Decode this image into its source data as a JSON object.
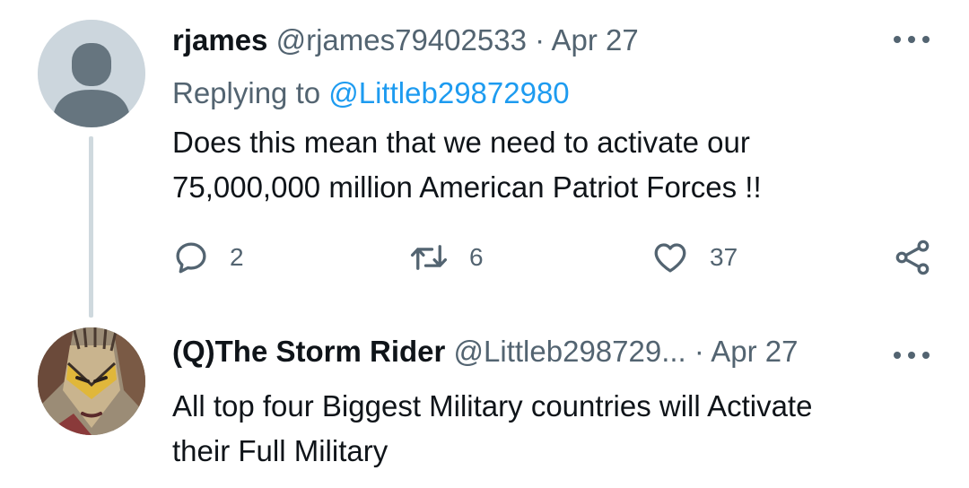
{
  "tweets": [
    {
      "display_name": "rjames",
      "handle": "@rjames79402533",
      "separator": "·",
      "date": "Apr 27",
      "replying_prefix": "Replying to",
      "replying_to": "@Littleb29872980",
      "text_lines": [
        "Does this mean that we need to activate our",
        "75,000,000 million American Patriot Forces !!"
      ],
      "stats": {
        "replies": "2",
        "retweets": "6",
        "likes": "37"
      },
      "avatar_icon": "default-profile-icon"
    },
    {
      "display_name": "(Q)The Storm Rider",
      "handle": "@Littleb298729...",
      "separator": "·",
      "date": "Apr 27",
      "text_lines": [
        "All top four Biggest Military countries will Activate",
        "their Full Military"
      ],
      "avatar_icon": "painted-face-avatar"
    }
  ],
  "colors": {
    "text": "#0f1419",
    "secondary": "#536471",
    "link": "#1d9bf0",
    "thread_line": "#cfd9de"
  },
  "icons": [
    "more-icon",
    "reply-icon",
    "retweet-icon",
    "like-icon",
    "share-icon"
  ]
}
